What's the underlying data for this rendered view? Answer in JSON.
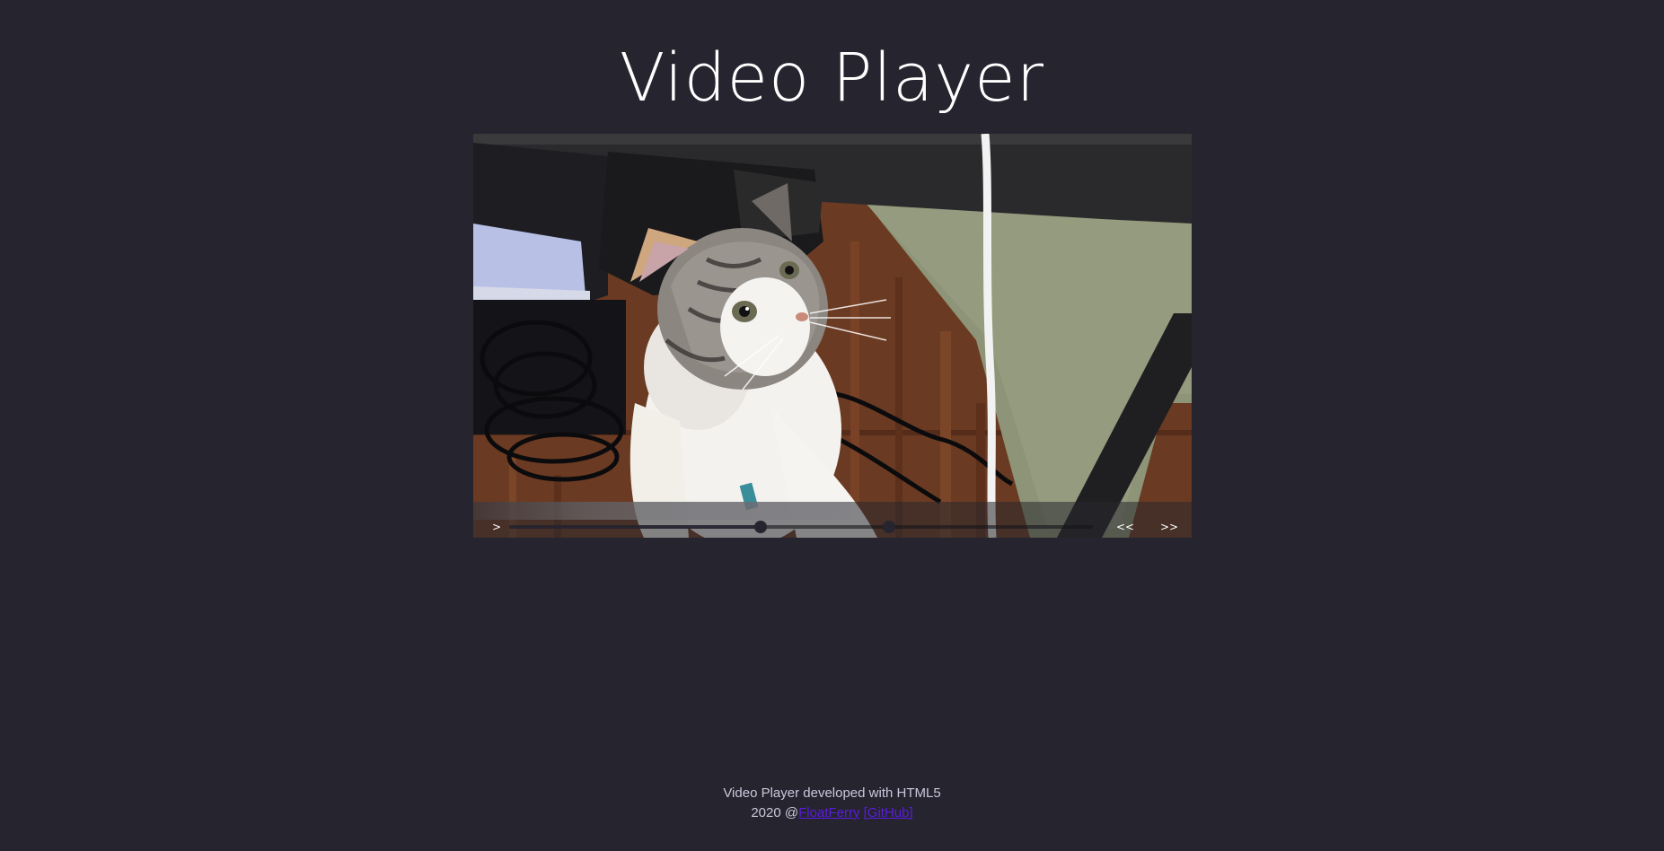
{
  "page": {
    "title": "Video Player",
    "background_color": "#26242f"
  },
  "player": {
    "play_label": ">",
    "rewind_label": "<<",
    "forward_label": ">>",
    "buffered_fraction": 0.525,
    "progress_fraction": 0.43,
    "volume_fraction": 0.65
  },
  "footer": {
    "line1": "Video Player developed with HTML5",
    "prefix": "2020 @",
    "author_link": "FloatFerry",
    "github_link": "[GitHub]",
    "link_color": "#5a1ce0"
  }
}
